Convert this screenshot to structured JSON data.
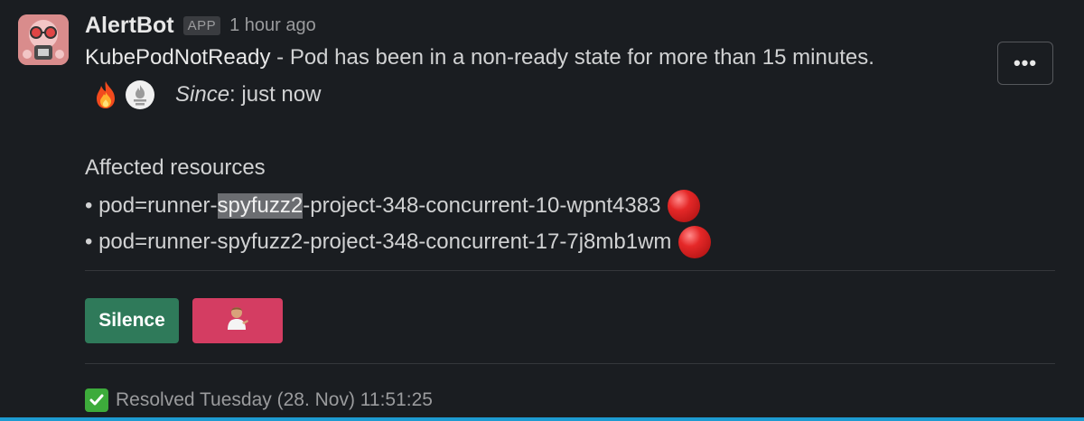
{
  "message": {
    "sender": "AlertBot",
    "app_badge": "APP",
    "time": "1 hour ago",
    "alert_name": "KubePodNotReady",
    "description": " - Pod has been in a non-ready state for more than 15 minutes.",
    "since_label": "Since",
    "since_value": ": just now",
    "icons": [
      "fire-icon",
      "prometheus-icon"
    ]
  },
  "affected": {
    "title": "Affected resources",
    "resources": [
      {
        "bullet": "•",
        "prefix": "pod=runner-",
        "highlight": "spyfuzz2",
        "suffix": "-project-348-concurrent-10-wpnt4383",
        "status_icon": "red-circle-icon"
      },
      {
        "bullet": "•",
        "prefix": "pod=runner-",
        "highlight": "",
        "suffix": "spyfuzz2-project-348-concurrent-17-7j8mb1wm",
        "status_icon": "red-circle-icon"
      }
    ]
  },
  "actions": {
    "silence_label": "Silence",
    "emoji_button_icon": "person-tipping-hand-icon"
  },
  "more_actions_label": "•••",
  "footer": {
    "resolved_text": "Resolved Tuesday (28. Nov) 11:51:25",
    "icon": "white-check-mark-icon"
  },
  "colors": {
    "background": "#1a1d21",
    "silence_button": "#2f7a5a",
    "emoji_button": "#d43d62",
    "highlight": "#6b6d71",
    "accent": "#1d9bd1"
  }
}
